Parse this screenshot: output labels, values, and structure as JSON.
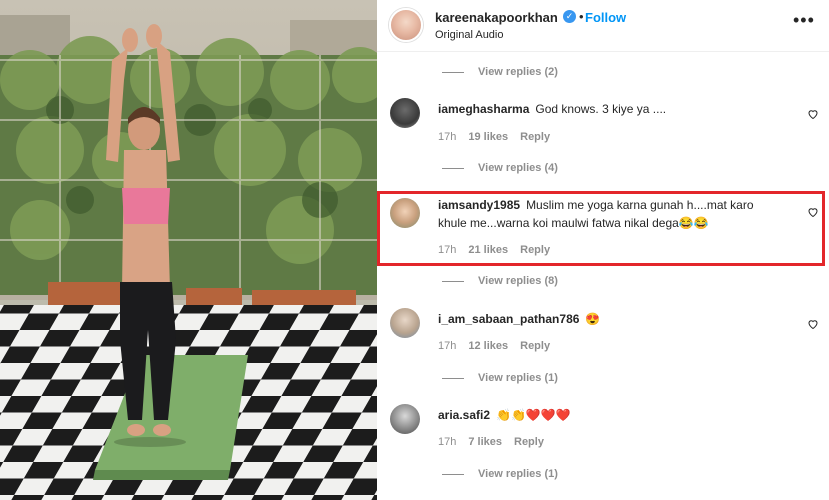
{
  "header": {
    "username": "kareenakapoorkhan",
    "verified_icon": "verified-badge-icon",
    "separator": "•",
    "follow_label": "Follow",
    "audio_label": "Original Audio",
    "more_icon": "more-options-icon"
  },
  "reply_threads": [
    {
      "label": "View replies (2)"
    },
    {
      "label": "View replies (4)"
    },
    {
      "label": "View replies (8)"
    },
    {
      "label": "View replies (1)"
    },
    {
      "label": "View replies (1)"
    }
  ],
  "comments": [
    {
      "username": "iameghasharma",
      "text": "God knows. 3 kiye ya ....",
      "time": "17h",
      "likes": "19 likes",
      "reply_label": "Reply"
    },
    {
      "username": "iamsandy1985",
      "text": "Muslim me yoga karna gunah h....mat karo khule me...warna koi maulwi fatwa nikal dega",
      "emojis": "😂😂",
      "time": "17h",
      "likes": "21 likes",
      "reply_label": "Reply",
      "highlighted": true
    },
    {
      "username": "i_am_sabaan_pathan786",
      "text": "",
      "emojis": "😍",
      "time": "17h",
      "likes": "12 likes",
      "reply_label": "Reply"
    },
    {
      "username": "aria.safi2",
      "text": "",
      "emojis": "👏👏❤️❤️❤️",
      "time": "17h",
      "likes": "7 likes",
      "reply_label": "Reply"
    }
  ],
  "colors": {
    "accent": "#0095f6",
    "highlight_border": "#e3262a",
    "muted": "#8e8e8e"
  }
}
